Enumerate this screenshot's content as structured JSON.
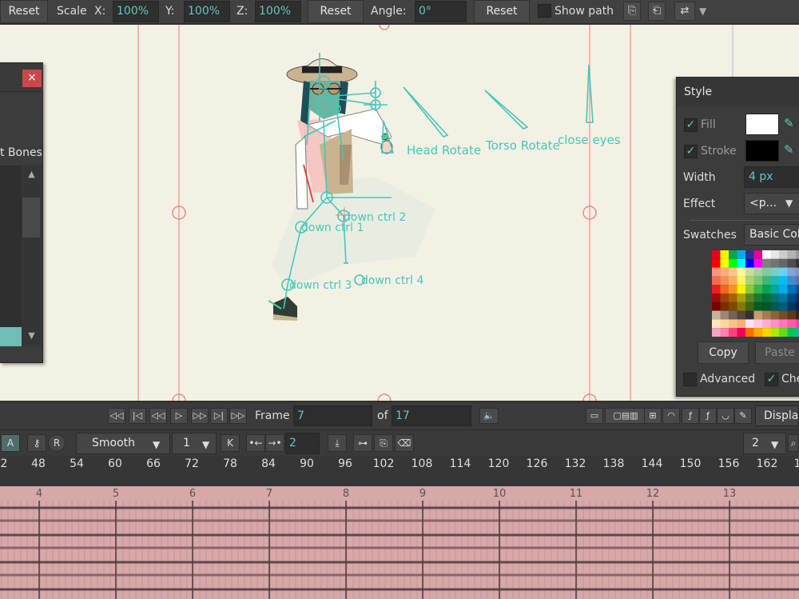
{
  "toolbar": {
    "reset1": "Reset",
    "scale_label": "Scale",
    "x_label": "X:",
    "x_value": "100%",
    "y_label": "Y:",
    "y_value": "100%",
    "z_label": "Z:",
    "z_value": "100%",
    "reset2": "Reset",
    "angle_label": "Angle:",
    "angle_value": "0°",
    "reset3": "Reset",
    "show_path": "Show path"
  },
  "canvas": {
    "labels": {
      "head_rotate": "Head Rotate",
      "torso_rotate": "Torso Rotate",
      "close_eyes": "close eyes",
      "down_ctrl_1": "down ctrl 1",
      "down_ctrl_2": "down ctrl 2",
      "down_ctrl_3": "down ctrl 3",
      "down_ctrl_4": "down ctrl 4"
    }
  },
  "left_panel": {
    "close": "×",
    "tab_bones": "t Bones"
  },
  "style_panel": {
    "title": "Style",
    "fill_label": "Fill",
    "stroke_label": "Stroke",
    "width_label": "Width",
    "width_value": "4 px",
    "effect_label": "Effect",
    "effect_value": "<p...",
    "swatches_label": "Swatches",
    "swatches_value": "Basic Col",
    "copy": "Copy",
    "paste": "Paste",
    "advanced": "Advanced",
    "che": "Che",
    "colors": {
      "fill": "#ffffff",
      "stroke": "#000000"
    }
  },
  "playback": {
    "frame_label": "Frame",
    "frame_value": "7",
    "of_label": "of",
    "total_frames": "17",
    "display": "Displa"
  },
  "timeline_toolbar": {
    "interp": "Smooth",
    "step": "1",
    "keys_value": "2",
    "zoom_value": "2"
  },
  "ruler": {
    "ticks": [
      "2",
      "48",
      "54",
      "60",
      "66",
      "72",
      "78",
      "84",
      "90",
      "96",
      "102",
      "108",
      "114",
      "120",
      "126",
      "132",
      "138",
      "144",
      "150",
      "156",
      "162",
      "1"
    ]
  },
  "tracks": {
    "frames": [
      "4",
      "5",
      "6",
      "7",
      "8",
      "9",
      "10",
      "11",
      "12",
      "13"
    ]
  }
}
